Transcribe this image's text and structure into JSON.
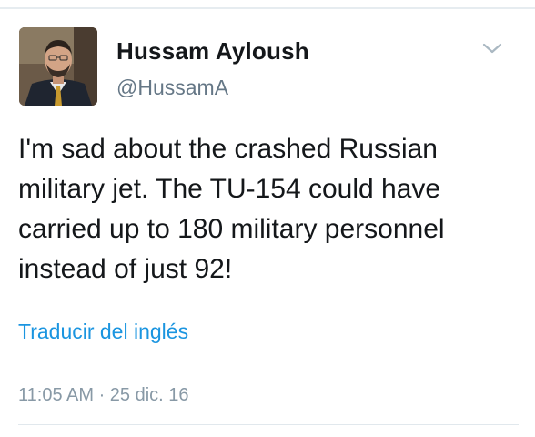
{
  "user": {
    "display_name": "Hussam Ayloush",
    "handle": "@HussamA",
    "avatar_icon": "profile-photo"
  },
  "tweet": {
    "lines": [
      "I'm sad about the crashed Russian",
      "military jet. The TU-154 could have",
      "carried up to 180 military personnel",
      "instead of just 92!"
    ],
    "translate_label": "Traducir del inglés",
    "timestamp": "11:05 AM · 25 dic. 16"
  },
  "icons": {
    "menu": "chevron-down-icon"
  },
  "colors": {
    "text": "#14171a",
    "secondary": "#657786",
    "link": "#1b95e0",
    "timestamp": "#8899a6"
  }
}
